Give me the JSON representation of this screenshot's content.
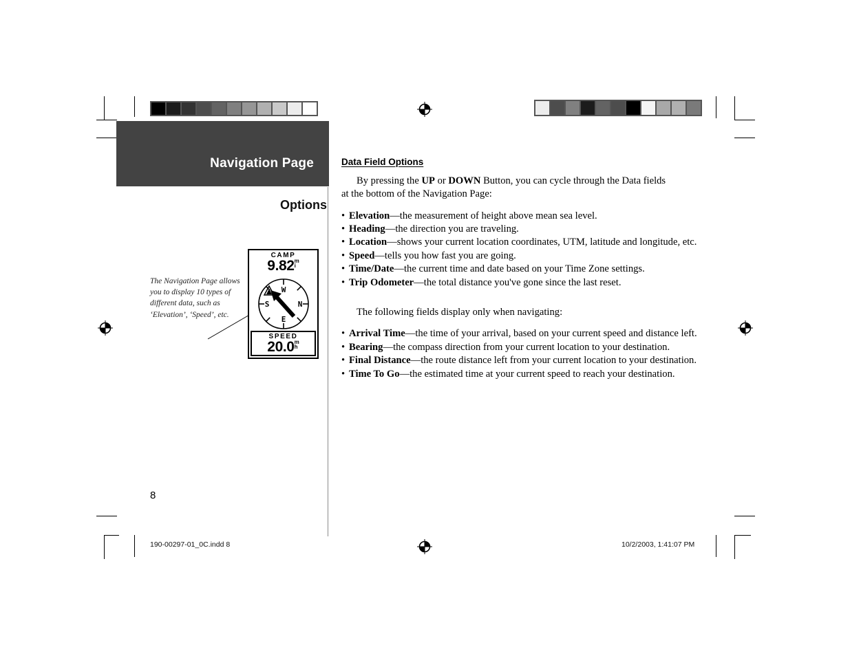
{
  "document": {
    "chapter_title": "Navigation Page",
    "section_heading": "Options",
    "page_number": "8",
    "footer_left": "190-00297-01_0C.indd   8",
    "footer_right": "10/2/2003, 1:41:07 PM"
  },
  "figure": {
    "caption": "The Navigation Page allows you to display 10 types of different data, such as ‘Elevation’, ‘Speed’, etc.",
    "gps_screen": {
      "top_field_label": "CAMP",
      "top_field_value": "9.82",
      "top_field_unit_line1": "m",
      "top_field_unit_line2": "i",
      "bottom_field_label": "SPEED",
      "bottom_field_value": "20.0",
      "bottom_field_unit_line1": "m",
      "bottom_field_unit_line2": "h",
      "compass_north": "N",
      "compass_south": "S",
      "compass_east": "E",
      "compass_west": "W",
      "waypoint_icon": "campground-tent-icon"
    }
  },
  "body": {
    "heading": "Data Field Options",
    "intro_parts": {
      "p1": "By pressing the ",
      "b1": "UP",
      "p2": " or ",
      "b2": "DOWN",
      "p3": " Button, you can cycle through the Data fields at the bottom of the Navigation Page:"
    },
    "data_fields": [
      {
        "term": "Elevation",
        "desc": "—the measurement of height above mean sea level."
      },
      {
        "term": "Heading",
        "desc": "—the direction you are traveling."
      },
      {
        "term": "Location",
        "desc": "—shows your current location coordinates, UTM, latitude and longitude, etc."
      },
      {
        "term": "Speed",
        "desc": "—tells you how fast you are going."
      },
      {
        "term": "Time/Date",
        "desc": "—the current time and date based on your Time Zone settings."
      },
      {
        "term": "Trip Odometer",
        "desc": "—the total distance you've gone since the last reset."
      }
    ],
    "navigating_intro": "The following fields display only when navigating:",
    "navigating_fields": [
      {
        "term": "Arrival Time",
        "desc": "—the time of your arrival, based on your current speed and distance left."
      },
      {
        "term": "Bearing",
        "desc": "—the compass direction from your current location to your destination."
      },
      {
        "term": "Final Distance",
        "desc": "—the route distance left from your current location to your destination."
      },
      {
        "term": "Time To Go",
        "desc": "—the estimated time at your current speed to reach your destination."
      }
    ]
  },
  "print_marks": {
    "grayscale_bar_left": [
      "#000000",
      "#1c1c1c",
      "#333333",
      "#4d4d4d",
      "#636363",
      "#808080",
      "#969696",
      "#b0b0b0",
      "#c9c9c9",
      "#ececec",
      "#ffffff"
    ],
    "grayscale_bar_right": [
      "#ececec",
      "#4d4d4d",
      "#808080",
      "#1c1c1c",
      "#636363",
      "#4d4d4d",
      "#000000",
      "#f4f4f4",
      "#a8a8a8",
      "#b0b0b0",
      "#7a7a7a"
    ],
    "registration_marks": [
      "top-center",
      "left-middle",
      "right-middle",
      "bottom-center"
    ],
    "header_block_color": "#434343"
  }
}
